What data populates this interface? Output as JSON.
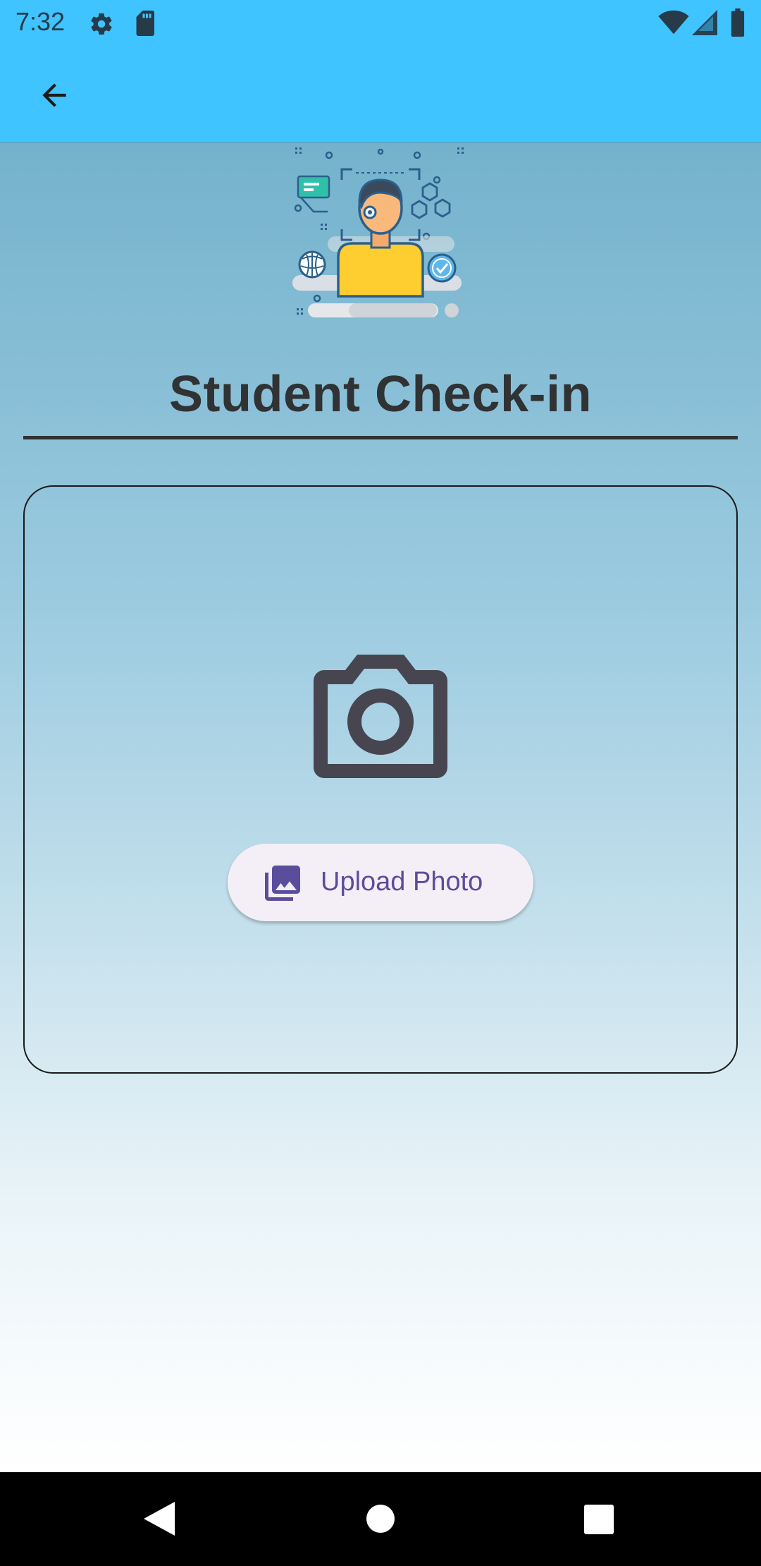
{
  "status_bar": {
    "time": "7:32",
    "left_icons": [
      "gear-icon",
      "sd-card-icon"
    ],
    "right_icons": [
      "wifi-icon",
      "signal-icon",
      "battery-icon"
    ]
  },
  "app_bar": {
    "back_icon": "arrow-left-icon",
    "background_color": "#40c4ff"
  },
  "page": {
    "title": "Student Check-in",
    "title_color": "#303234"
  },
  "photo_card": {
    "camera_icon": "camera-icon",
    "upload_button": {
      "label": "Upload Photo",
      "icon": "photo-library-icon",
      "text_color": "#5a4d9c",
      "background": "#f4eff6"
    }
  },
  "nav_bar": {
    "buttons": [
      "back-triangle-icon",
      "home-circle-icon",
      "recents-square-icon"
    ]
  },
  "colors": {
    "gradient_top": "#74b2cc",
    "gradient_bottom": "#ffffff"
  }
}
